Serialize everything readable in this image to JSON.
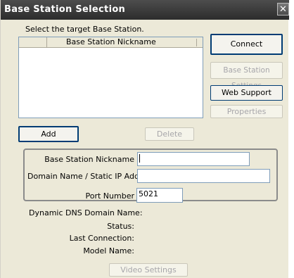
{
  "window": {
    "title": "Base Station Selection",
    "close_glyph": "✕"
  },
  "main": {
    "instruction": "Select the target Base Station.",
    "list_column_header": "Base Station Nickname",
    "buttons": {
      "connect": "Connect",
      "base_station_settings": "Base Station Settings",
      "web_support": "Web Support",
      "properties": "Properties",
      "add": "Add",
      "delete": "Delete",
      "video_settings": "Video Settings"
    }
  },
  "form": {
    "nickname_label": "Base Station Nickname",
    "nickname_value": "",
    "domain_label": "Domain Name / Static IP Address",
    "domain_value": "",
    "port_label": "Port Number",
    "port_value": "5021"
  },
  "info": {
    "dns_label": "Dynamic DNS Domain Name:",
    "status_label": "Status:",
    "last_connection_label": "Last Connection:",
    "model_label": "Model Name:"
  }
}
